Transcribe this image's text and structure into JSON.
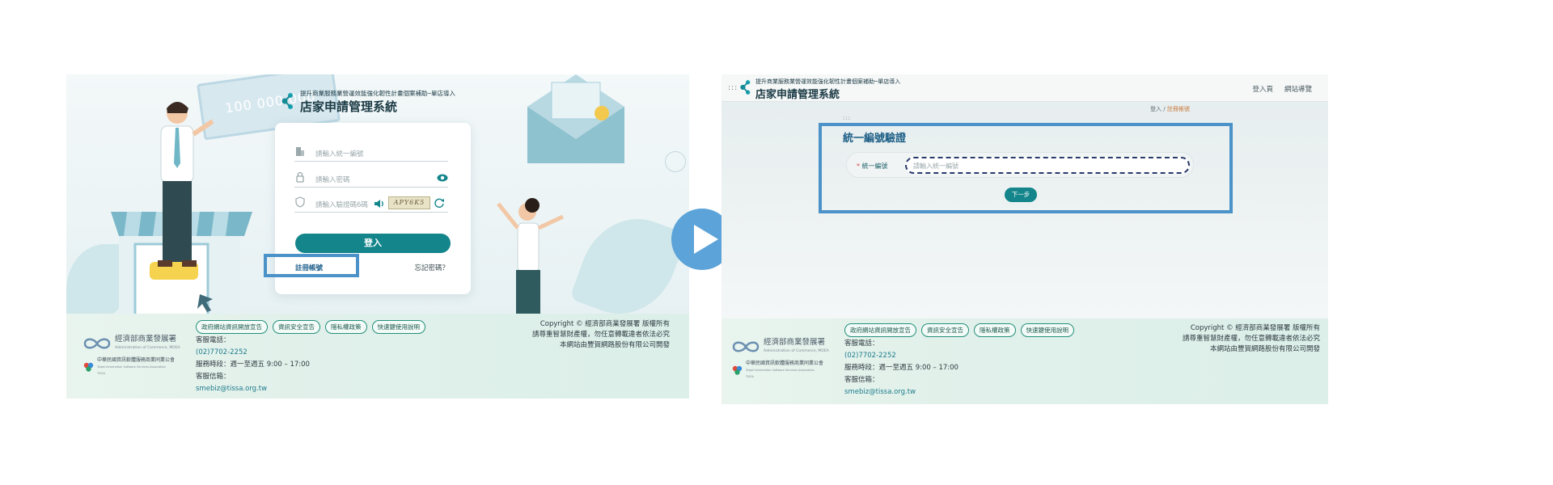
{
  "left_panel": {
    "deco_money": "100 000 000",
    "brand": {
      "subtitle": "提升商業服務業營運效能強化韌性計畫個案補助─單店導入",
      "title": "店家申請管理系統"
    },
    "login_form": {
      "tax_id_placeholder": "請輸入統一編號",
      "password_placeholder": "請輸入密碼",
      "captcha_placeholder": "請輸入驗證碼6碼",
      "captcha_text": "APY6K5",
      "login_label": "登入",
      "register_label": "註冊帳號",
      "forgot_label": "忘記密碼？"
    }
  },
  "footer": {
    "links": [
      "政府網站資訊開放宣告",
      "資訊安全宣告",
      "隱私權政策",
      "快速鍵使用說明"
    ],
    "moea_name": "經濟部商業發展署",
    "moea_en": "Administration of Commerce, MOEA",
    "tissa_name": "中華民國資訊軟體服務商業同業公會",
    "tissa_en": "Taipei Information Software Services Association",
    "tissa_abbr": "TISSA",
    "phone_label": "客服電話：",
    "phone": "(02)7702-2252",
    "hours": "服務時段：週一至週五 9:00 – 17:00",
    "email_label": "客服信箱：",
    "email": "smebiz@tissa.org.tw",
    "copyright_line1": "Copyright © 經濟部商業發展署 版權所有",
    "copyright_line2": "請尊重智慧財產權，勿任意轉載違者依法必究",
    "copyright_line3": "本網站由豐賀網路股份有限公司開發"
  },
  "right_panel": {
    "brand": {
      "subtitle": "提升商業服務業營運效能強化韌性計畫個案補助─單店導入",
      "title": "店家申請管理系統"
    },
    "nav": [
      "登入頁",
      "網站導覽"
    ],
    "breadcrumb": {
      "home": "登入",
      "sep": "/",
      "current": "註冊帳號"
    },
    "menu_dots": ":::",
    "section_dots": ":::",
    "section_title": "統一編號驗證",
    "field_required": "*",
    "field_label": "統一編號",
    "field_placeholder": "請輸入統一編號",
    "next_label": "下一步"
  },
  "colors": {
    "teal": "#13858b",
    "highlight": "#4a92c8",
    "play": "#5ba3d8",
    "title_blue": "#1d5f86"
  }
}
